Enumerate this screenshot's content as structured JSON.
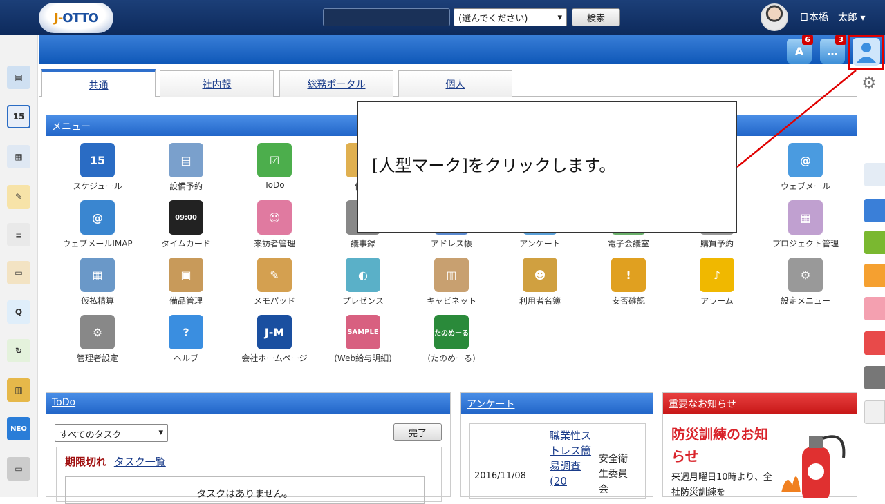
{
  "header": {
    "logo_text_prefix": "J-",
    "logo_text_suffix": "OTTO",
    "select_value": "(選んでください)",
    "search_button": "検索",
    "user_name": "日本橋　太郎"
  },
  "notifications": [
    {
      "icon": "antenna-icon",
      "count": "6",
      "glyph": "A"
    },
    {
      "icon": "chat-icon",
      "count": "3",
      "glyph": "…"
    }
  ],
  "tabs": [
    {
      "label": "共通",
      "active": true
    },
    {
      "label": "社内報",
      "active": false
    },
    {
      "label": "総務ポータル",
      "active": false
    },
    {
      "label": "個人",
      "active": false
    }
  ],
  "menu_panel": {
    "title": "メニュー",
    "items": [
      {
        "label": "スケジュール",
        "icon": "calendar-icon",
        "glyph": "15",
        "color": "#2a6cc4"
      },
      {
        "label": "設備予約",
        "icon": "facility-icon",
        "glyph": "▤",
        "color": "#7aa0cc"
      },
      {
        "label": "ToDo",
        "icon": "todo-icon",
        "glyph": "☑",
        "color": "#4cae4c"
      },
      {
        "label": "伝言",
        "icon": "message-icon",
        "glyph": "✉",
        "color": "#e0b050"
      },
      {
        "label": "ウェブメール",
        "icon": "webmail-icon",
        "glyph": "@",
        "color": "#4a9be0"
      },
      {
        "label": "ウェブメールIMAP",
        "icon": "webmail-imap-icon",
        "glyph": "@",
        "color": "#3a86d0"
      },
      {
        "label": "タイムカード",
        "icon": "timecard-icon",
        "glyph": "09:00",
        "color": "#222"
      },
      {
        "label": "来訪者管理",
        "icon": "visitor-icon",
        "glyph": "☺",
        "color": "#e07aa0"
      },
      {
        "label": "議事録",
        "icon": "minutes-icon",
        "glyph": "≡",
        "color": "#888"
      },
      {
        "label": "アドレス帳",
        "icon": "address-book-icon",
        "glyph": "☎",
        "color": "#5a8ad0"
      },
      {
        "label": "アンケート",
        "icon": "survey-icon",
        "glyph": "?",
        "color": "#5aa0d8"
      },
      {
        "label": "電子会議室",
        "icon": "conference-icon",
        "glyph": "◉",
        "color": "#6ab06a"
      },
      {
        "label": "購買予約",
        "icon": "purchase-icon",
        "glyph": "⚙",
        "color": "#999"
      },
      {
        "label": "プロジェクト管理",
        "icon": "project-icon",
        "glyph": "▦",
        "color": "#c0a0d0"
      },
      {
        "label": "仮払精算",
        "icon": "advance-payment-icon",
        "glyph": "▦",
        "color": "#6a98c8"
      },
      {
        "label": "備品管理",
        "icon": "equipment-icon",
        "glyph": "▣",
        "color": "#c89a5a"
      },
      {
        "label": "メモパッド",
        "icon": "memo-icon",
        "glyph": "✎",
        "color": "#d4a050"
      },
      {
        "label": "プレゼンス",
        "icon": "presence-icon",
        "glyph": "◐",
        "color": "#5ab0c8"
      },
      {
        "label": "キャビネット",
        "icon": "cabinet-icon",
        "glyph": "▥",
        "color": "#c8a070"
      },
      {
        "label": "利用者名簿",
        "icon": "user-list-icon",
        "glyph": "☻",
        "color": "#d0a040"
      },
      {
        "label": "安否確認",
        "icon": "safety-icon",
        "glyph": "!",
        "color": "#e0a020"
      },
      {
        "label": "アラーム",
        "icon": "alarm-icon",
        "glyph": "♪",
        "color": "#f0b800"
      },
      {
        "label": "設定メニュー",
        "icon": "settings-menu-icon",
        "glyph": "⚙",
        "color": "#999"
      },
      {
        "label": "管理者設定",
        "icon": "admin-settings-icon",
        "glyph": "⚙",
        "color": "#888"
      },
      {
        "label": "ヘルプ",
        "icon": "help-icon",
        "glyph": "?",
        "color": "#3a8ee0"
      },
      {
        "label": "会社ホームページ",
        "icon": "company-homepage-icon",
        "glyph": "J-M",
        "color": "#1a4fa0"
      },
      {
        "label": "(Web給与明細)",
        "icon": "web-payslip-icon",
        "glyph": "SAMPLE",
        "color": "#d86080"
      },
      {
        "label": "(たのめーる)",
        "icon": "tanomail-icon",
        "glyph": "たのめーる",
        "color": "#2a8a3a"
      }
    ]
  },
  "callout": {
    "text": "[人型マーク]をクリックします。"
  },
  "todo_panel": {
    "title": "ToDo",
    "filter_value": "すべてのタスク",
    "done_button": "完了",
    "overdue_label": "期限切れ",
    "task_list_link": "タスク一覧",
    "empty_message": "タスクはありません。"
  },
  "survey_panel": {
    "title": "アンケート",
    "date": "2016/11/08",
    "link": "職業性ストレス簡易調査(20",
    "owner": "安全衛生委員会"
  },
  "notice_panel": {
    "title": "重要なお知らせ",
    "headline": "防災訓練のお知らせ",
    "body": "来週月曜日10時より、全社防災訓練を"
  },
  "colors": {
    "accent": "#2266c9",
    "notice_red": "#d9232a",
    "highlight": "#e00000"
  }
}
